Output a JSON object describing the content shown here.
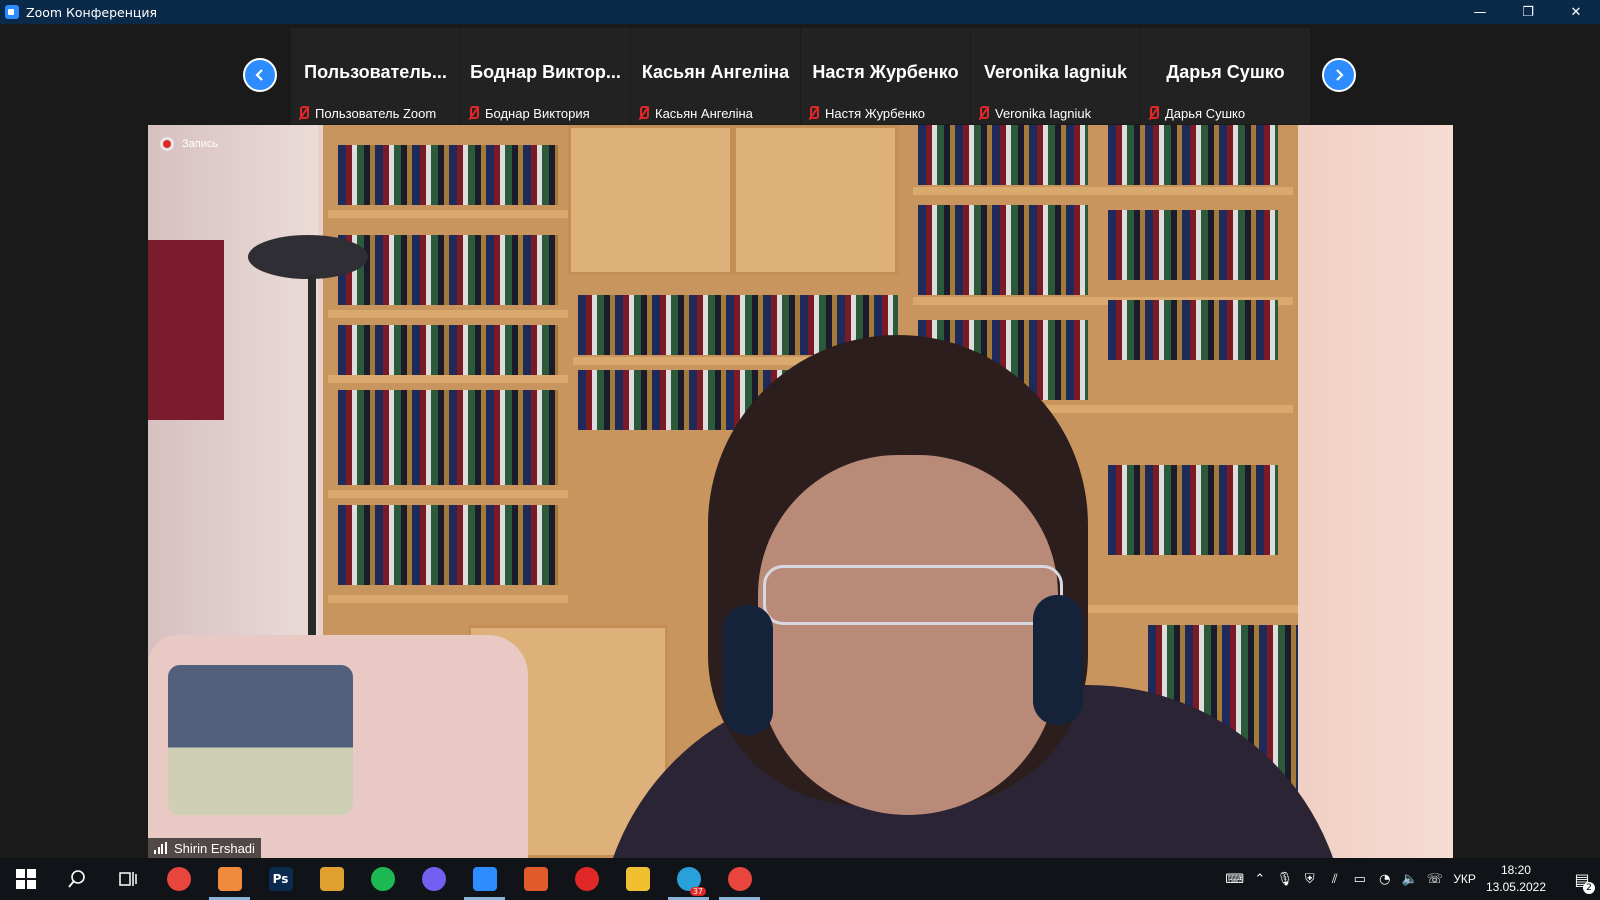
{
  "window": {
    "title": "Zoom Конференция",
    "minimize_glyph": "—",
    "restore_glyph": "❐",
    "close_glyph": "✕"
  },
  "strip": {
    "prev_icon": "chevron-left-icon",
    "next_icon": "chevron-right-icon",
    "participants": [
      {
        "display_name": "Пользователь...",
        "label": "Пользователь Zoom",
        "muted": true
      },
      {
        "display_name": "Боднар Виктор...",
        "label": "Боднар Виктория",
        "muted": true
      },
      {
        "display_name": "Касьян Ангеліна",
        "label": "Касьян Ангеліна",
        "muted": true
      },
      {
        "display_name": "Настя Журбенко",
        "label": "Настя Журбенко",
        "muted": true
      },
      {
        "display_name": "Veronika Iagniuk",
        "label": "Veronika Iagniuk",
        "muted": true
      },
      {
        "display_name": "Дарья  Сушко",
        "label": "Дарья  Сушко",
        "muted": true
      }
    ]
  },
  "video": {
    "recording_label": "Запись",
    "speaker_name": "Shirin Ershadi"
  },
  "taskbar": {
    "apps": [
      {
        "name": "chrome",
        "color": "#e8453c"
      },
      {
        "name": "app-orange",
        "color": "#f08a3c",
        "active": true
      },
      {
        "name": "photoshop",
        "color": "#0a2a4e",
        "text": "Ps"
      },
      {
        "name": "app-yellow",
        "color": "#e0a030"
      },
      {
        "name": "spotify",
        "color": "#1db954"
      },
      {
        "name": "viber",
        "color": "#7360f2"
      },
      {
        "name": "zoom",
        "color": "#2d8cff",
        "active": true
      },
      {
        "name": "app-stripes",
        "color": "#e05a2a"
      },
      {
        "name": "recorder",
        "color": "#e02828"
      },
      {
        "name": "file-explorer",
        "color": "#f0c030"
      },
      {
        "name": "telegram",
        "color": "#2aa0da",
        "badge": "37",
        "active": true
      },
      {
        "name": "chrome-2",
        "color": "#e8453c",
        "active": true
      }
    ],
    "language": "УКР",
    "time": "18:20",
    "date": "13.05.2022",
    "notification_count": "2"
  }
}
